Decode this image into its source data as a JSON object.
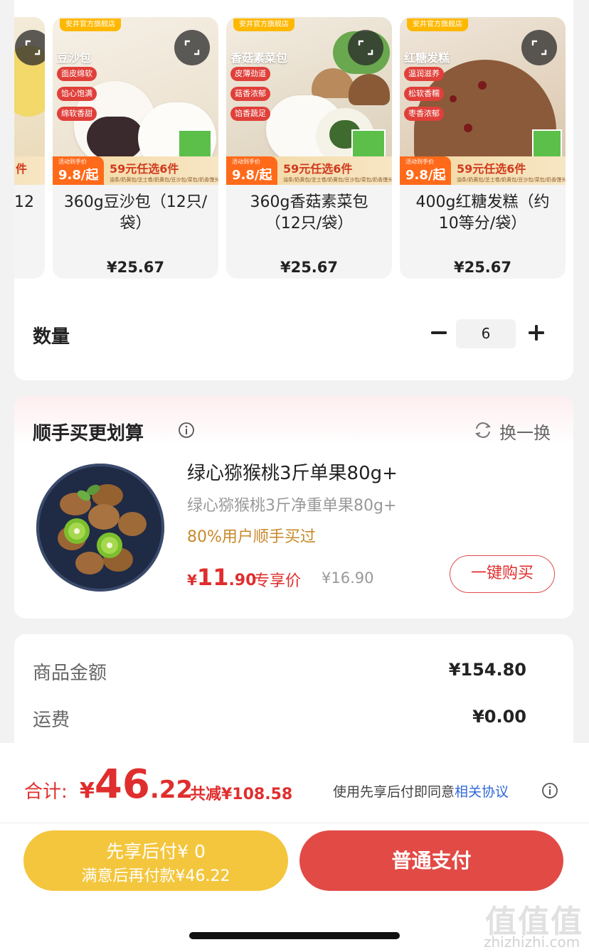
{
  "products": [
    {
      "name": "360g豆沙包（12只/袋）",
      "price": "¥25.67",
      "img_label": "豆沙包",
      "pills": [
        "面皮绵软",
        "馅心饱满",
        "绵软香甜"
      ],
      "shop_tag": "安井官方旗舰店",
      "promo_activity": "活动到手价",
      "promo_price": "9.8/起",
      "promo_deal": "59元任选6件",
      "promo_sub": "油条/奶黄包/芝士卷/奶黄包/豆沙包/菜包/奶香馒头"
    },
    {
      "name": "360g香菇素菜包（12只/袋）",
      "price": "¥25.67",
      "img_label": "香菇素菜包",
      "pills": [
        "皮薄劲道",
        "菇香浓郁",
        "馅香蔬足"
      ],
      "shop_tag": "安井官方旗舰店",
      "promo_activity": "活动到手价",
      "promo_price": "9.8/起",
      "promo_deal": "59元任选6件",
      "promo_sub": "油条/奶黄包/芝士卷/奶黄包/豆沙包/菜包/奶香馒头"
    },
    {
      "name": "400g红糖发糕（约10等分/袋）",
      "price": "¥25.67",
      "img_label": "红糖发糕",
      "pills": [
        "温润滋养",
        "松软香糯",
        "枣香浓郁"
      ],
      "shop_tag": "安井官方旗舰店",
      "promo_activity": "活动到手价",
      "promo_price": "9.8/起",
      "promo_deal": "59元任选6件",
      "promo_sub": "油条/奶黄包/芝士卷/奶黄包/豆沙包/菜包/奶香馒头"
    }
  ],
  "partial_product": {
    "title_fragment": "12",
    "promo_fragment": "件"
  },
  "quantity": {
    "label": "数量",
    "value": "6"
  },
  "upsell": {
    "title": "顺手买更划算",
    "switch_label": "换一换",
    "item_name": "绿心猕猴桃3斤单果80g+",
    "item_spec": "绿心猕猴桃3斤净重单果80g+",
    "bought_hint": "80%用户顺手买过",
    "price_symbol": "¥",
    "price_int": "11",
    "price_dec": ".90",
    "exclusive_label": "专享价",
    "original_price": "¥16.90",
    "buy_button": "一键购买"
  },
  "summary": {
    "goods_label": "商品金额",
    "goods_value": "¥154.80",
    "shipping_label": "运费",
    "shipping_value": "¥0.00"
  },
  "footer": {
    "total_label": "合计:",
    "total_symbol": "¥",
    "total_int": "46",
    "total_dec": ".22",
    "saved": "共减¥108.58",
    "agree_text": "使用先享后付即同意",
    "agree_link": "相关协议",
    "pay_later_line1": "先享后付¥ 0",
    "pay_later_line2": "满意后再付款¥46.22",
    "pay_now": "普通支付"
  },
  "watermark": {
    "logo": "值值值",
    "url": "zhizhizhi.com"
  },
  "colors": {
    "accent_red": "#e02e2e",
    "pay_button": "#e24a45",
    "pay_later_button": "#f4c63d",
    "link_blue": "#2f68d8",
    "bought_gold": "#c7892a"
  }
}
